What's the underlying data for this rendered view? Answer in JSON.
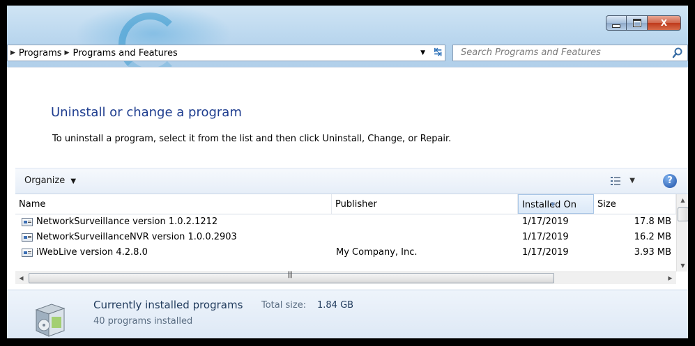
{
  "window": {
    "caption_buttons": {
      "minimize": "minimize",
      "maximize": "maximize",
      "close": "X"
    }
  },
  "address_bar": {
    "crumbs": [
      "Programs",
      "Programs and Features"
    ]
  },
  "search": {
    "placeholder": "Search Programs and Features"
  },
  "page": {
    "heading": "Uninstall or change a program",
    "instructions": "To uninstall a program, select it from the list and then click Uninstall, Change, or Repair."
  },
  "toolbar": {
    "organize_label": "Organize",
    "help_label": "?"
  },
  "table": {
    "columns": [
      {
        "label": "Name"
      },
      {
        "label": "Publisher"
      },
      {
        "label": "Installed On"
      },
      {
        "label": "Size"
      }
    ],
    "rows": [
      {
        "name": "NetworkSurveillance version 1.0.2.1212",
        "publisher": "",
        "installed_on": "1/17/2019",
        "size": "17.8 MB"
      },
      {
        "name": "NetworkSurveillanceNVR version 1.0.0.2903",
        "publisher": "",
        "installed_on": "1/17/2019",
        "size": "16.2 MB"
      },
      {
        "name": "iWebLive version 4.2.8.0",
        "publisher": "My Company, Inc.",
        "installed_on": "1/17/2019",
        "size": "3.93 MB"
      }
    ]
  },
  "details": {
    "title": "Currently installed programs",
    "total_size_label": "Total size:",
    "total_size_value": "1.84 GB",
    "count_text": "40 programs installed"
  },
  "colors": {
    "heading": "#1e3d8f",
    "accent": "#2a6fb8",
    "close_button": "#c0391b"
  }
}
